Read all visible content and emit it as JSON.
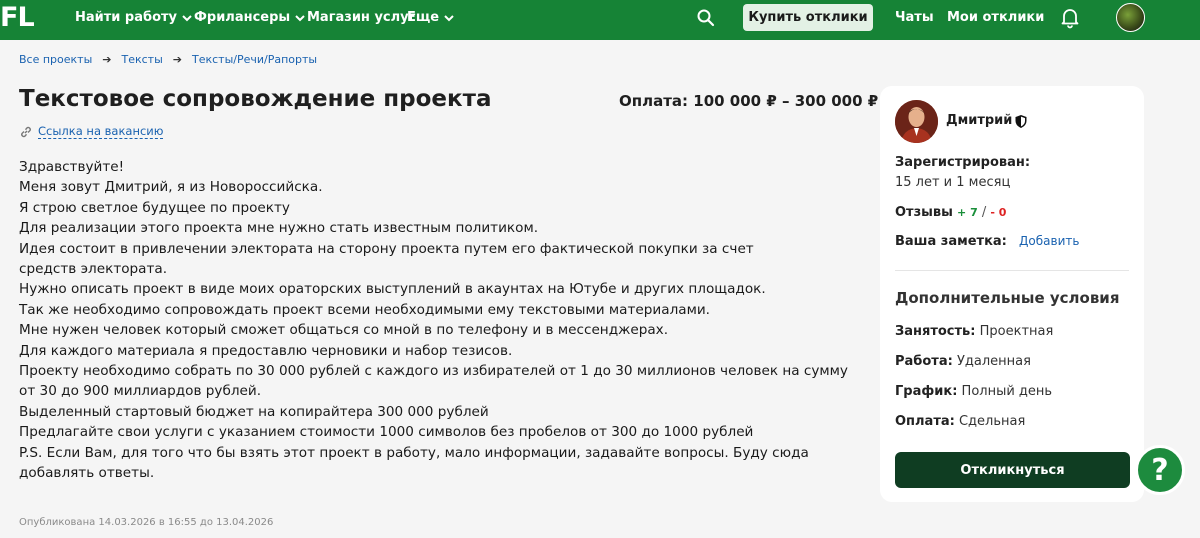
{
  "header": {
    "logo": "FL",
    "nav": [
      {
        "label": "Найти работу",
        "dropdown": true
      },
      {
        "label": "Фрилансеры",
        "dropdown": true
      },
      {
        "label": "Магазин услуг",
        "dropdown": false
      },
      {
        "label": "Еще",
        "dropdown": true
      }
    ],
    "buy_button": "Купить отклики",
    "chats": "Чаты",
    "my_responses": "Мои отклики",
    "brand_color": "#168336"
  },
  "breadcrumbs": [
    "Все проекты",
    "Тексты",
    "Тексты/Речи/Рапорты"
  ],
  "project": {
    "title": "Текстовое сопровождение проекта",
    "price": "Оплата: 100 000 ₽ – 300 000 ₽",
    "vacancy_link": "Ссылка на вакансию",
    "description": [
      "Здравствуйте!",
      "Меня зовут Дмитрий, я из Новороссийска.",
      "Я строю светлое будущее по проекту",
      "Для реализации этого проекта мне нужно стать известным политиком.",
      "Идея состоит в привлечении электората на сторону проекта путем его фактической покупки за счет средств электората.",
      "Нужно описать проект в виде моих ораторских выступлений в акаунтах на Ютубе и других площадок.",
      "Так же необходимо сопровождать проект всеми необходимыми ему текстовыми материалами.",
      "Мне нужен человек который сможет общаться со мной в по телефону и в мессенджерах.",
      "Для каждого материала я предоставлю черновики и набор тезисов.",
      "Проекту необходимо собрать по 30 000 рублей с каждого из избирателей от 1 до 30 миллионов человек на сумму от 30 до 900 миллиардов рублей.",
      "Выделенный стартовый бюджет на копирайтера 300 000 рублей",
      "Предлагайте свои услуги с указанием стоимости 1000 символов без пробелов от 300 до 1000 рублей",
      "P.S. Если Вам, для того что бы взять этот проект в работу, мало информации, задавайте вопросы. Буду сюда добавлять ответы."
    ],
    "published": "Опубликована 14.03.2026 в 16:55 до 13.04.2026"
  },
  "employer": {
    "name": "Дмитрий",
    "registered_label": "Зарегистрирован:",
    "registered_value": "15 лет и 1 месяц",
    "reviews_label": "Отзывы",
    "reviews_positive": "+ 7",
    "reviews_negative": "- 0",
    "note_label": "Ваша заметка:",
    "note_add": "Добавить"
  },
  "conditions": {
    "heading": "Дополнительные условия",
    "items": [
      {
        "label": "Занятость:",
        "value": "Проектная"
      },
      {
        "label": "Работа:",
        "value": "Удаленная"
      },
      {
        "label": "График:",
        "value": "Полный день"
      },
      {
        "label": "Оплата:",
        "value": "Сдельная"
      }
    ]
  },
  "respond_button": "Откликнуться",
  "help_button": "?"
}
